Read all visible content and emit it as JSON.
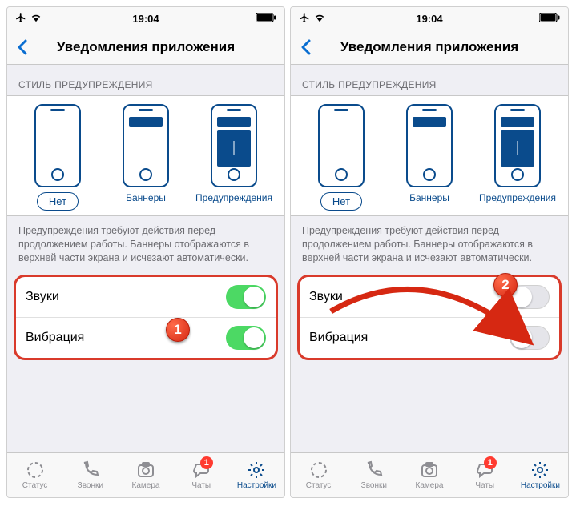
{
  "statusbar": {
    "time": "19:04"
  },
  "nav": {
    "title": "Уведомления приложения"
  },
  "section": {
    "styleHeader": "СТИЛЬ ПРЕДУПРЕЖДЕНИЯ",
    "options": {
      "none": "Нет",
      "banners": "Баннеры",
      "alerts": "Предупреждения"
    },
    "desc": "Предупреждения требуют действия перед продолжением работы. Баннеры отображаются в верхней части экрана и исчезают автоматически."
  },
  "rows": {
    "sounds": "Звуки",
    "vibration": "Вибрация"
  },
  "tabs": {
    "status": "Статус",
    "calls": "Звонки",
    "camera": "Камера",
    "chats": "Чаты",
    "settings": "Настройки",
    "chatsBadge": "1"
  },
  "markers": {
    "one": "1",
    "two": "2"
  },
  "screens": [
    {
      "soundsOn": true,
      "vibrationOn": true
    },
    {
      "soundsOn": false,
      "vibrationOn": false
    }
  ]
}
